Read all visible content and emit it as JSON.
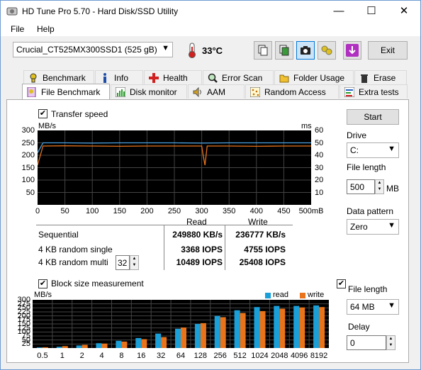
{
  "window": {
    "title": "HD Tune Pro 5.70 - Hard Disk/SSD Utility",
    "minimize": "—",
    "maximize": "☐",
    "close": "✕"
  },
  "menu": {
    "file": "File",
    "help": "Help"
  },
  "toolbar": {
    "drive": "Crucial_CT525MX300SSD1 (525 gB)",
    "temperature": "33°C",
    "exit_label": "Exit",
    "icons": [
      "copy-icon",
      "save-icon",
      "camera-icon",
      "options-icon",
      "download-icon"
    ]
  },
  "tabs_top": [
    {
      "label": "Benchmark",
      "icon": "benchmark-icon"
    },
    {
      "label": "Info",
      "icon": "info-icon"
    },
    {
      "label": "Health",
      "icon": "health-icon"
    },
    {
      "label": "Error Scan",
      "icon": "error-scan-icon"
    },
    {
      "label": "Folder Usage",
      "icon": "folder-icon"
    },
    {
      "label": "Erase",
      "icon": "trash-icon"
    }
  ],
  "tabs_bottom": [
    {
      "label": "File Benchmark",
      "icon": "file-benchmark-icon",
      "active": true
    },
    {
      "label": "Disk monitor",
      "icon": "disk-monitor-icon"
    },
    {
      "label": "AAM",
      "icon": "speaker-icon"
    },
    {
      "label": "Random Access",
      "icon": "random-access-icon"
    },
    {
      "label": "Extra tests",
      "icon": "extra-tests-icon"
    }
  ],
  "transfer": {
    "checkbox_label": "Transfer speed",
    "checked": true,
    "left_unit": "MB/s",
    "right_unit": "ms",
    "y_ticks": [
      "300",
      "250",
      "200",
      "150",
      "100",
      "50"
    ],
    "ms_ticks": [
      "60",
      "50",
      "40",
      "30",
      "20",
      "10"
    ],
    "x_ticks": [
      "0",
      "50",
      "100",
      "150",
      "200",
      "250",
      "300",
      "350",
      "400",
      "450",
      "500mB"
    ]
  },
  "results": {
    "read_header": "Read",
    "write_header": "Write",
    "rows": [
      {
        "label": "Sequential",
        "read": "249880 KB/s",
        "write": "236777 KB/s"
      },
      {
        "label": "4 KB random single",
        "read": "3368 IOPS",
        "write": "4755 IOPS"
      },
      {
        "label": "4 KB random multi",
        "read": "10489 IOPS",
        "write": "25408 IOPS",
        "queue": "32"
      }
    ]
  },
  "block": {
    "checkbox_label": "Block size measurement",
    "checked": true,
    "unit": "MB/s",
    "legend_read": "read",
    "legend_write": "write",
    "read_color": "#1a9fd8",
    "write_color": "#e8731a",
    "y_ticks": [
      "300",
      "275",
      "250",
      "225",
      "200",
      "175",
      "150",
      "125",
      "100",
      "75",
      "50",
      "25"
    ]
  },
  "side": {
    "start_label": "Start",
    "drive_label": "Drive",
    "drive_value": "C:",
    "file_length_label": "File length",
    "file_length_value": "500",
    "file_length_unit": "MB",
    "pattern_label": "Data pattern",
    "pattern_value": "Zero",
    "block_file_length_label": "File length",
    "block_file_length_value": "64 MB",
    "delay_label": "Delay",
    "delay_value": "0"
  },
  "chart_data": [
    {
      "type": "line",
      "title": "Transfer speed",
      "xlabel": "mB",
      "ylabel": "MB/s",
      "xlim": [
        0,
        500
      ],
      "ylim": [
        0,
        300
      ],
      "series": [
        {
          "name": "Read",
          "x": [
            0,
            10,
            50,
            100,
            150,
            200,
            250,
            300,
            350,
            400,
            450,
            500
          ],
          "values": [
            210,
            250,
            250,
            249,
            250,
            250,
            250,
            249,
            250,
            250,
            250,
            250
          ]
        },
        {
          "name": "Write",
          "x": [
            0,
            10,
            50,
            100,
            150,
            200,
            250,
            300,
            303,
            306,
            310,
            350,
            400,
            450,
            500
          ],
          "values": [
            160,
            237,
            238,
            237,
            236,
            237,
            237,
            237,
            195,
            160,
            237,
            237,
            236,
            237,
            237
          ]
        }
      ]
    },
    {
      "type": "bar",
      "title": "Block size measurement",
      "ylabel": "MB/s",
      "ylim": [
        0,
        300
      ],
      "categories": [
        "0.5",
        "1",
        "2",
        "4",
        "8",
        "16",
        "32",
        "64",
        "128",
        "256",
        "512",
        "1024",
        "2048",
        "4096",
        "8192"
      ],
      "series": [
        {
          "name": "read",
          "values": [
            4,
            8,
            16,
            30,
            45,
            62,
            90,
            120,
            150,
            200,
            235,
            255,
            262,
            262,
            265
          ]
        },
        {
          "name": "write",
          "values": [
            5,
            12,
            20,
            28,
            40,
            55,
            68,
            128,
            155,
            192,
            218,
            230,
            245,
            253,
            255
          ]
        }
      ]
    }
  ]
}
